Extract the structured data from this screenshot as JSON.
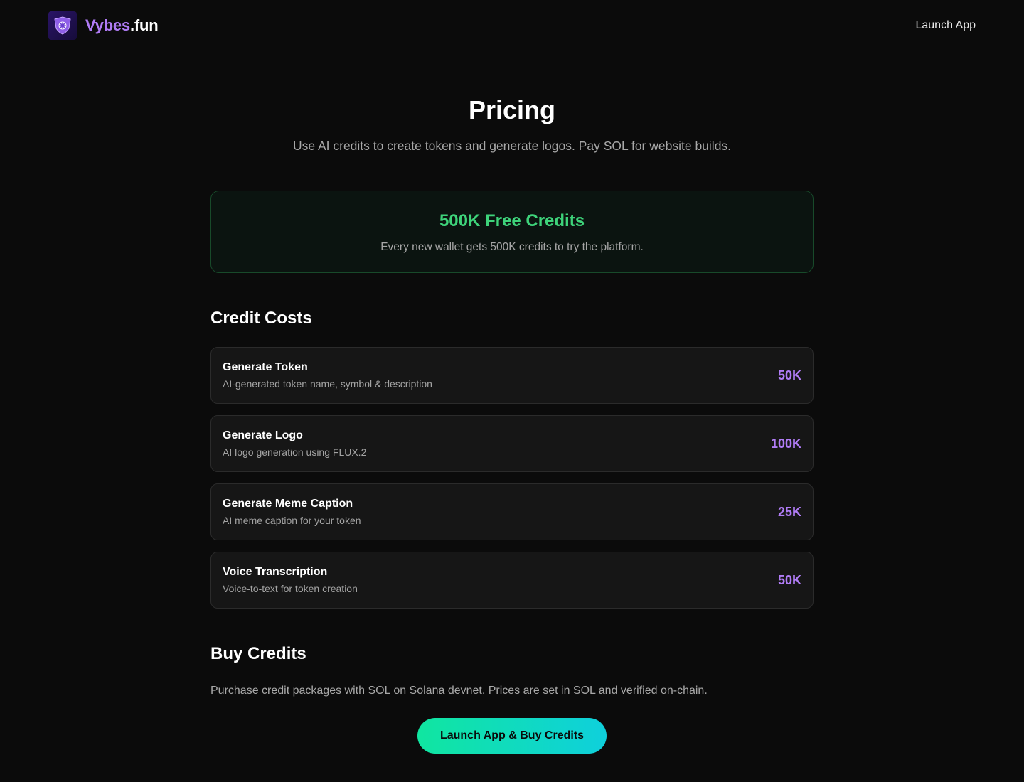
{
  "header": {
    "brand_accent": "Vybes",
    "brand_rest": ".fun",
    "logo_icon": "shield-sparkle-icon",
    "launch_link": "Launch App"
  },
  "hero": {
    "title": "Pricing",
    "subtitle": "Use AI credits to create tokens and generate logos. Pay SOL for website builds."
  },
  "free_banner": {
    "title": "500K Free Credits",
    "description": "Every new wallet gets 500K credits to try the platform."
  },
  "credit_costs": {
    "title": "Credit Costs",
    "items": [
      {
        "name": "Generate Token",
        "description": "AI-generated token name, symbol & description",
        "price": "50K"
      },
      {
        "name": "Generate Logo",
        "description": "AI logo generation using FLUX.2",
        "price": "100K"
      },
      {
        "name": "Generate Meme Caption",
        "description": "AI meme caption for your token",
        "price": "25K"
      },
      {
        "name": "Voice Transcription",
        "description": "Voice-to-text for token creation",
        "price": "50K"
      }
    ]
  },
  "buy_credits": {
    "title": "Buy Credits",
    "description": "Purchase credit packages with SOL on Solana devnet. Prices are set in SOL and verified on-chain.",
    "button_label": "Launch App & Buy Credits"
  },
  "colors": {
    "background": "#0b0b0b",
    "accent_purple": "#b07cf5",
    "accent_green": "#3ed37a",
    "cta_gradient_start": "#10e6a0",
    "cta_gradient_end": "#0fd0dc"
  }
}
